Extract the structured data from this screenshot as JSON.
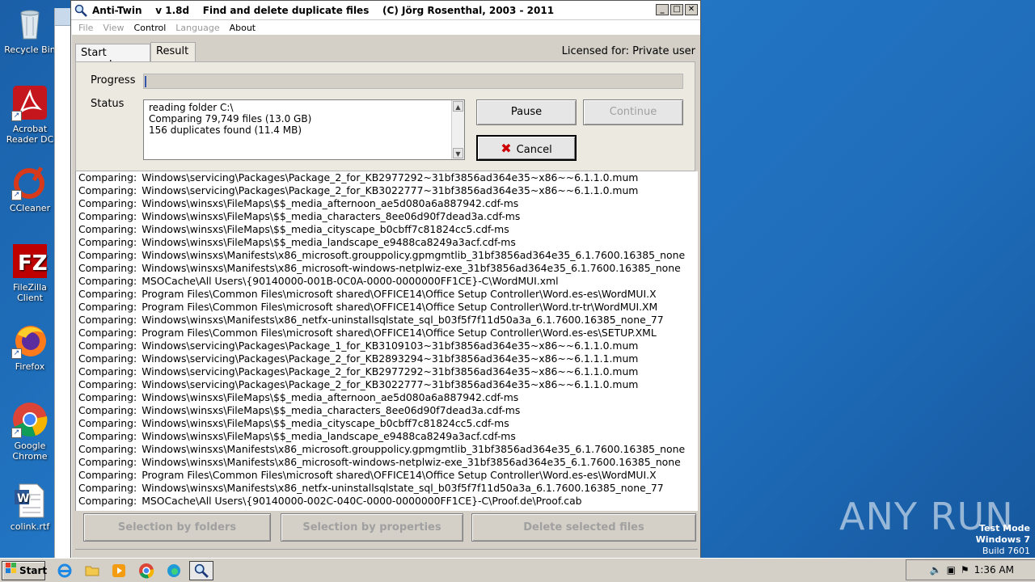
{
  "desktop": {
    "icons": [
      {
        "label": "Recycle Bin",
        "icon": "recycle-bin-icon"
      },
      {
        "label": "Acrobat Reader DC",
        "icon": "acrobat-icon"
      },
      {
        "label": "CCleaner",
        "icon": "ccleaner-icon"
      },
      {
        "label": "FileZilla Client",
        "icon": "filezilla-icon"
      },
      {
        "label": "Firefox",
        "icon": "firefox-icon"
      },
      {
        "label": "Google Chrome",
        "icon": "chrome-icon"
      },
      {
        "label": "colink.rtf",
        "icon": "word-document-icon"
      }
    ]
  },
  "window": {
    "title": "Anti-Twin    v 1.8d    Find and delete duplicate files    (C) Jörg Rosenthal, 2003 - 2011",
    "menu": [
      {
        "label": "File",
        "enabled": false
      },
      {
        "label": "View",
        "enabled": false
      },
      {
        "label": "Control",
        "enabled": true
      },
      {
        "label": "Language",
        "enabled": false
      },
      {
        "label": "About",
        "enabled": true
      }
    ],
    "tabs": [
      {
        "label": "Start search",
        "active": false
      },
      {
        "label": "Result",
        "active": true
      }
    ],
    "licensed": "Licensed for: Private user",
    "progress_label": "Progress",
    "status_label": "Status",
    "status_lines": [
      "reading folder C:\\",
      "Comparing 79,749 files (13.0 GB)",
      "156 duplicates found (11.4 MB)"
    ],
    "buttons": {
      "pause": "Pause",
      "continue": "Continue",
      "cancel": "Cancel"
    },
    "log_prefix": "Comparing:",
    "log": [
      "Windows\\servicing\\Packages\\Package_2_for_KB2977292~31bf3856ad364e35~x86~~6.1.1.0.mum",
      "Windows\\servicing\\Packages\\Package_2_for_KB3022777~31bf3856ad364e35~x86~~6.1.1.0.mum",
      "Windows\\winsxs\\FileMaps\\$$_media_afternoon_ae5d080a6a887942.cdf-ms",
      "Windows\\winsxs\\FileMaps\\$$_media_characters_8ee06d90f7dead3a.cdf-ms",
      "Windows\\winsxs\\FileMaps\\$$_media_cityscape_b0cbff7c81824cc5.cdf-ms",
      "Windows\\winsxs\\FileMaps\\$$_media_landscape_e9488ca8249a3acf.cdf-ms",
      "Windows\\winsxs\\Manifests\\x86_microsoft.grouppolicy.gpmgmtlib_31bf3856ad364e35_6.1.7600.16385_none",
      "Windows\\winsxs\\Manifests\\x86_microsoft-windows-netplwiz-exe_31bf3856ad364e35_6.1.7600.16385_none",
      "MSOCache\\All Users\\{90140000-001B-0C0A-0000-0000000FF1CE}-C\\WordMUI.xml",
      "Program Files\\Common Files\\microsoft shared\\OFFICE14\\Office Setup Controller\\Word.es-es\\WordMUI.X",
      "Program Files\\Common Files\\microsoft shared\\OFFICE14\\Office Setup Controller\\Word.tr-tr\\WordMUI.XM",
      "Windows\\winsxs\\Manifests\\x86_netfx-uninstallsqlstate_sql_b03f5f7f11d50a3a_6.1.7600.16385_none_77",
      "Program Files\\Common Files\\microsoft shared\\OFFICE14\\Office Setup Controller\\Word.es-es\\SETUP.XML",
      "Windows\\servicing\\Packages\\Package_1_for_KB3109103~31bf3856ad364e35~x86~~6.1.1.0.mum",
      "Windows\\servicing\\Packages\\Package_2_for_KB2893294~31bf3856ad364e35~x86~~6.1.1.1.mum",
      "Windows\\servicing\\Packages\\Package_2_for_KB2977292~31bf3856ad364e35~x86~~6.1.1.0.mum",
      "Windows\\servicing\\Packages\\Package_2_for_KB3022777~31bf3856ad364e35~x86~~6.1.1.0.mum",
      "Windows\\winsxs\\FileMaps\\$$_media_afternoon_ae5d080a6a887942.cdf-ms",
      "Windows\\winsxs\\FileMaps\\$$_media_characters_8ee06d90f7dead3a.cdf-ms",
      "Windows\\winsxs\\FileMaps\\$$_media_cityscape_b0cbff7c81824cc5.cdf-ms",
      "Windows\\winsxs\\FileMaps\\$$_media_landscape_e9488ca8249a3acf.cdf-ms",
      "Windows\\winsxs\\Manifests\\x86_microsoft.grouppolicy.gpmgmtlib_31bf3856ad364e35_6.1.7600.16385_none",
      "Windows\\winsxs\\Manifests\\x86_microsoft-windows-netplwiz-exe_31bf3856ad364e35_6.1.7600.16385_none",
      "Program Files\\Common Files\\microsoft shared\\OFFICE14\\Office Setup Controller\\Word.es-es\\WordMUI.X",
      "Windows\\winsxs\\Manifests\\x86_netfx-uninstallsqlstate_sql_b03f5f7f11d50a3a_6.1.7600.16385_none_77",
      "MSOCache\\All Users\\{90140000-002C-040C-0000-0000000FF1CE}-C\\Proof.de\\Proof.cab"
    ],
    "bottom_buttons": {
      "by_folders": "Selection by folders",
      "by_properties": "Selection by properties",
      "delete": "Delete selected files"
    }
  },
  "watermark": {
    "brand": "ANY RUN",
    "test_mode": "Test Mode",
    "os": "Windows 7",
    "build": "Build 7601"
  },
  "taskbar": {
    "start_label": "Start",
    "clock": "1:36 AM"
  }
}
